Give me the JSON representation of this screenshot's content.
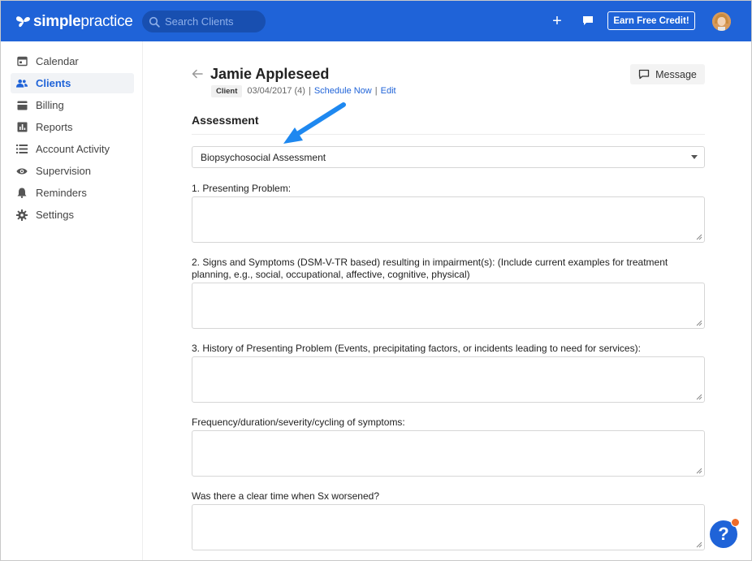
{
  "app": {
    "logo_bold": "simple",
    "logo_light": "practice",
    "search_placeholder": "Search Clients",
    "earn_button": "Earn Free Credit!",
    "accent": "#1f63d8"
  },
  "sidebar": {
    "items": [
      {
        "label": "Calendar",
        "icon": "calendar-icon",
        "active": false
      },
      {
        "label": "Clients",
        "icon": "people-icon",
        "active": true
      },
      {
        "label": "Billing",
        "icon": "billing-icon",
        "active": false
      },
      {
        "label": "Reports",
        "icon": "reports-icon",
        "active": false
      },
      {
        "label": "Account Activity",
        "icon": "list-icon",
        "active": false
      },
      {
        "label": "Supervision",
        "icon": "eye-icon",
        "active": false
      },
      {
        "label": "Reminders",
        "icon": "bell-icon",
        "active": false
      },
      {
        "label": "Settings",
        "icon": "gear-icon",
        "active": false
      }
    ]
  },
  "client": {
    "name": "Jamie Appleseed",
    "badge": "Client",
    "dob": "03/04/2017 (4)",
    "schedule_link": "Schedule Now",
    "edit_link": "Edit",
    "message_button": "Message"
  },
  "assessment": {
    "section_title": "Assessment",
    "selected_form": "Biopsychosocial Assessment",
    "questions": [
      {
        "label": "1. Presenting Problem:",
        "value": ""
      },
      {
        "label": "2. Signs and Symptoms (DSM-V-TR based) resulting in impairment(s): (Include current examples for treatment planning, e.g., social, occupational, affective, cognitive, physical)",
        "value": ""
      },
      {
        "label": "3. History of Presenting Problem (Events, precipitating factors, or incidents leading to need for services):",
        "value": ""
      },
      {
        "label": "Frequency/duration/severity/cycling of symptoms:",
        "value": ""
      },
      {
        "label": "Was there a clear time when Sx worsened?",
        "value": ""
      }
    ]
  },
  "help": {
    "label": "?"
  }
}
